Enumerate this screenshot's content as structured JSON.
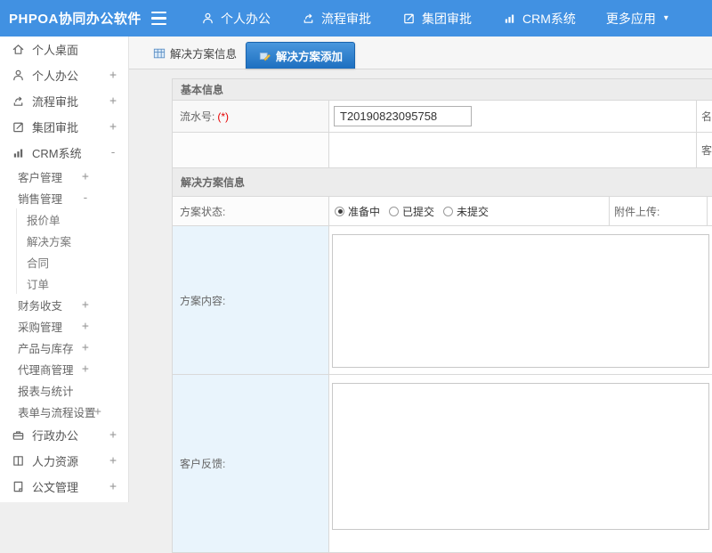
{
  "colors": {
    "navbar_bg": "#4191e2",
    "active_tab_bg": "#2176c7",
    "section_header_bg": "#ececec",
    "highlight_cell_bg": "#e9f4fc",
    "required_red": "#e60000"
  },
  "navbar": {
    "brand": "PHPOA协同办公软件",
    "menu": [
      {
        "name": "personal-office",
        "label": "个人办公",
        "icon": "user-icon"
      },
      {
        "name": "workflow-approval",
        "label": "流程审批",
        "icon": "flow-icon"
      },
      {
        "name": "group-approval",
        "label": "集团审批",
        "icon": "edit-icon"
      },
      {
        "name": "crm-system",
        "label": "CRM系统",
        "icon": "chart-icon"
      },
      {
        "name": "more-apps",
        "label": "更多应用",
        "icon": "",
        "caret": "▾"
      }
    ]
  },
  "sidebar": {
    "items": [
      {
        "name": "personal-desktop",
        "label": "个人桌面",
        "icon": "home-icon",
        "level": 1,
        "exp": ""
      },
      {
        "name": "personal-office",
        "label": "个人办公",
        "icon": "user-icon",
        "level": 1,
        "exp": "+"
      },
      {
        "name": "workflow-approval",
        "label": "流程审批",
        "icon": "flow-icon",
        "level": 1,
        "exp": "+"
      },
      {
        "name": "group-approval",
        "label": "集团审批",
        "icon": "edit-icon",
        "level": 1,
        "exp": "+"
      },
      {
        "name": "crm-system",
        "label": "CRM系统",
        "icon": "chart-icon",
        "level": 1,
        "exp": "-"
      },
      {
        "name": "customer-mgmt",
        "label": "客户管理",
        "level": 2,
        "exp": "+"
      },
      {
        "name": "sales-mgmt",
        "label": "销售管理",
        "level": 2,
        "exp": "-"
      },
      {
        "name": "quotation",
        "label": "报价单",
        "level": 3,
        "exp": ""
      },
      {
        "name": "solution",
        "label": "解决方案",
        "level": 3,
        "exp": ""
      },
      {
        "name": "contract",
        "label": "合同",
        "level": 3,
        "exp": ""
      },
      {
        "name": "order",
        "label": "订单",
        "level": 3,
        "exp": ""
      },
      {
        "name": "finance",
        "label": "财务收支",
        "level": 2,
        "exp": "+"
      },
      {
        "name": "purchase-mgmt",
        "label": "采购管理",
        "level": 2,
        "exp": "+"
      },
      {
        "name": "product-inventory",
        "label": "产品与库存",
        "level": 2,
        "exp": "+"
      },
      {
        "name": "agent-mgmt",
        "label": "代理商管理",
        "level": 2,
        "exp": "+"
      },
      {
        "name": "reports-stats",
        "label": "报表与统计",
        "level": 2,
        "exp": ""
      },
      {
        "name": "form-flow-settings",
        "label": "表单与流程设置",
        "level": 2,
        "exp": "+",
        "tight": true
      },
      {
        "name": "admin-office",
        "label": "行政办公",
        "icon": "briefcase-icon",
        "level": 1,
        "exp": "+"
      },
      {
        "name": "human-resources",
        "label": "人力资源",
        "icon": "book-icon",
        "level": 1,
        "exp": "+"
      },
      {
        "name": "document-mgmt",
        "label": "公文管理",
        "icon": "doc-icon",
        "level": 1,
        "exp": "+"
      }
    ]
  },
  "tabs": {
    "info": "解决方案信息",
    "add": "解决方案添加"
  },
  "form": {
    "section_basic": "基本信息",
    "serial_label": "流水号:",
    "required_mark": "(*)",
    "serial_value": "T20190823095758",
    "name_label": "名称:",
    "customer_label": "客户:",
    "section_solution": "解决方案信息",
    "status_label": "方案状态:",
    "status_options": [
      {
        "label": "准备中",
        "checked": true
      },
      {
        "label": "已提交",
        "checked": false
      },
      {
        "label": "未提交",
        "checked": false
      }
    ],
    "attachment_label": "附件上传:",
    "content_label": "方案内容:",
    "feedback_label": "客户反馈:"
  }
}
